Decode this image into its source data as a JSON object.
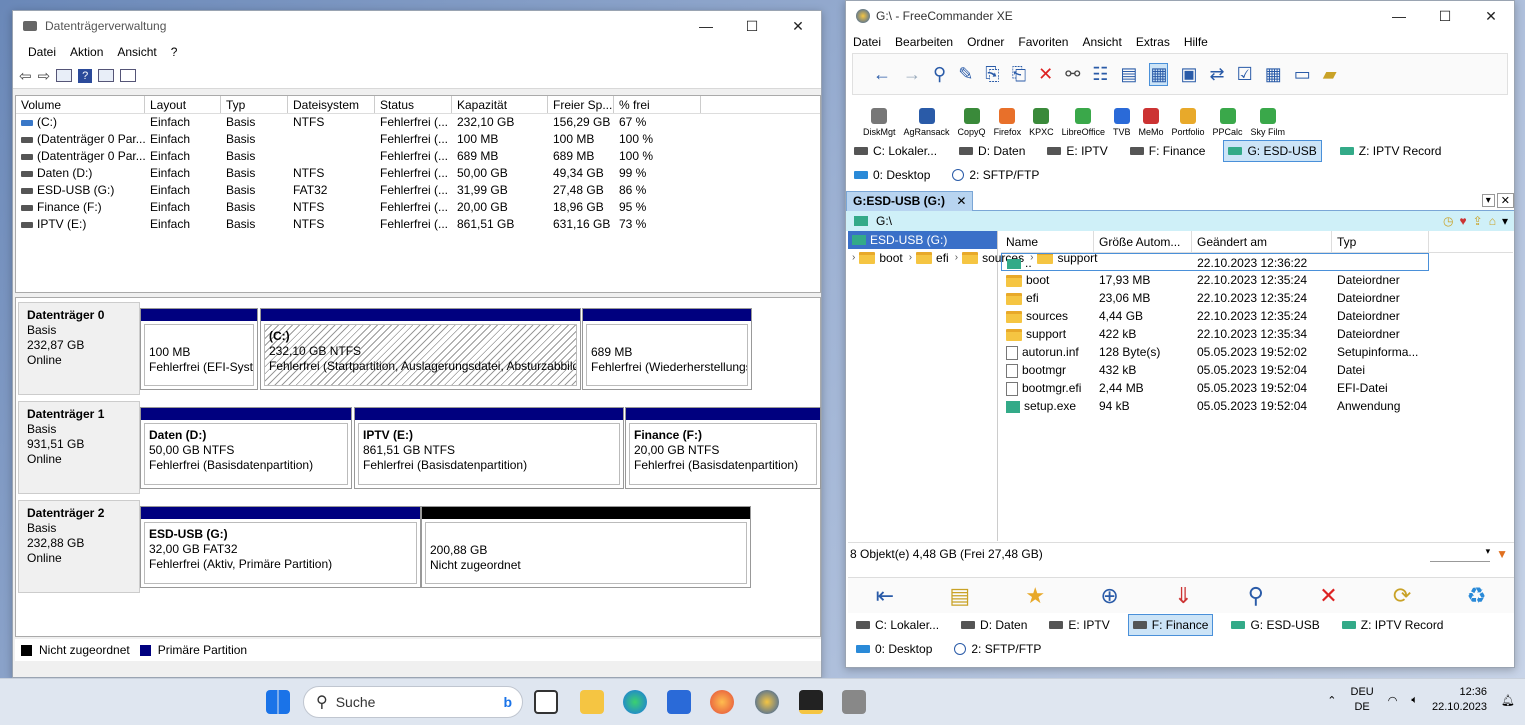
{
  "dm": {
    "title": "Datenträgerverwaltung",
    "menu": [
      "Datei",
      "Aktion",
      "Ansicht",
      "?"
    ],
    "columns": [
      "Volume",
      "Layout",
      "Typ",
      "Dateisystem",
      "Status",
      "Kapazität",
      "Freier Sp...",
      "% frei"
    ],
    "volumes": [
      [
        "(C:)",
        "Einfach",
        "Basis",
        "NTFS",
        "Fehlerfrei (...",
        "232,10 GB",
        "156,29 GB",
        "67 %"
      ],
      [
        "(Datenträger 0 Par...",
        "Einfach",
        "Basis",
        "",
        "Fehlerfrei (...",
        "100 MB",
        "100 MB",
        "100 %"
      ],
      [
        "(Datenträger 0 Par...",
        "Einfach",
        "Basis",
        "",
        "Fehlerfrei (...",
        "689 MB",
        "689 MB",
        "100 %"
      ],
      [
        "Daten (D:)",
        "Einfach",
        "Basis",
        "NTFS",
        "Fehlerfrei (...",
        "50,00 GB",
        "49,34 GB",
        "99 %"
      ],
      [
        "ESD-USB (G:)",
        "Einfach",
        "Basis",
        "FAT32",
        "Fehlerfrei (...",
        "31,99 GB",
        "27,48 GB",
        "86 %"
      ],
      [
        "Finance (F:)",
        "Einfach",
        "Basis",
        "NTFS",
        "Fehlerfrei (...",
        "20,00 GB",
        "18,96 GB",
        "95 %"
      ],
      [
        "IPTV (E:)",
        "Einfach",
        "Basis",
        "NTFS",
        "Fehlerfrei (...",
        "861,51 GB",
        "631,16 GB",
        "73 %"
      ]
    ],
    "disks": [
      {
        "name": "Datenträger 0",
        "type": "Basis",
        "size": "232,87 GB",
        "state": "Online",
        "parts": [
          {
            "title": "",
            "line1": "100 MB",
            "line2": "Fehlerfrei (EFI-Syste"
          },
          {
            "title": "(C:)",
            "line1": "232,10 GB NTFS",
            "line2": "Fehlerfrei (Startpartition, Auslagerungsdatei, Absturzabbild"
          },
          {
            "title": "",
            "line1": "689 MB",
            "line2": "Fehlerfrei (Wiederherstellungs"
          }
        ]
      },
      {
        "name": "Datenträger 1",
        "type": "Basis",
        "size": "931,51 GB",
        "state": "Online",
        "parts": [
          {
            "title": "Daten  (D:)",
            "line1": "50,00 GB NTFS",
            "line2": "Fehlerfrei (Basisdatenpartition)"
          },
          {
            "title": "IPTV  (E:)",
            "line1": "861,51 GB NTFS",
            "line2": "Fehlerfrei (Basisdatenpartition)"
          },
          {
            "title": "Finance  (F:)",
            "line1": "20,00 GB NTFS",
            "line2": "Fehlerfrei (Basisdatenpartition)"
          }
        ]
      },
      {
        "name": "Datenträger 2",
        "type": "Basis",
        "size": "232,88 GB",
        "state": "Online",
        "parts": [
          {
            "title": "ESD-USB  (G:)",
            "line1": "32,00 GB FAT32",
            "line2": "Fehlerfrei (Aktiv, Primäre Partition)"
          },
          {
            "title": "",
            "line1": "200,88 GB",
            "line2": "Nicht zugeordnet"
          }
        ]
      }
    ],
    "legend_unalloc": "Nicht zugeordnet",
    "legend_primary": "Primäre Partition",
    "colors": {
      "primary": "#00007f",
      "unallocated": "#000000"
    }
  },
  "fc": {
    "title": "G:\\ - FreeCommander XE",
    "menu": [
      "Datei",
      "Bearbeiten",
      "Ordner",
      "Favoriten",
      "Ansicht",
      "Extras",
      "Hilfe"
    ],
    "apps": [
      "DiskMgt",
      "AgRansack",
      "CopyQ",
      "Firefox",
      "KPXC",
      "LibreOffice",
      "TVB",
      "MeMo",
      "Portfolio",
      "PPCalc",
      "Sky Film"
    ],
    "drives_top": [
      "C: Lokaler...",
      "D: Daten",
      "E: IPTV",
      "F: Finance",
      "G: ESD-USB",
      "Z: IPTV Record"
    ],
    "drives_top2": [
      "0: Desktop",
      "2: SFTP/FTP"
    ],
    "tab": "G:ESD-USB (G:)",
    "path": "G:\\",
    "tree_root": "ESD-USB (G:)",
    "tree": [
      "boot",
      "efi",
      "sources",
      "support"
    ],
    "columns": [
      "Name",
      "Größe Autom...",
      "Geändert am",
      "Typ"
    ],
    "files": [
      [
        "..",
        "",
        "22.10.2023 12:36:22",
        ""
      ],
      [
        "boot",
        "17,93 MB",
        "22.10.2023 12:35:24",
        "Dateiordner"
      ],
      [
        "efi",
        "23,06 MB",
        "22.10.2023 12:35:24",
        "Dateiordner"
      ],
      [
        "sources",
        "4,44 GB",
        "22.10.2023 12:35:24",
        "Dateiordner"
      ],
      [
        "support",
        "422 kB",
        "22.10.2023 12:35:34",
        "Dateiordner"
      ],
      [
        "autorun.inf",
        "128 Byte(s)",
        "05.05.2023 19:52:02",
        "Setupinforma..."
      ],
      [
        "bootmgr",
        "432 kB",
        "05.05.2023 19:52:04",
        "Datei"
      ],
      [
        "bootmgr.efi",
        "2,44 MB",
        "05.05.2023 19:52:04",
        "EFI-Datei"
      ],
      [
        "setup.exe",
        "94 kB",
        "05.05.2023 19:52:04",
        "Anwendung"
      ]
    ],
    "status": "8 Objekt(e)  4,48 GB  (Frei 27,48 GB)",
    "drives_bottom": [
      "C: Lokaler...",
      "D: Daten",
      "E: IPTV",
      "F: Finance",
      "G: ESD-USB",
      "Z: IPTV Record"
    ],
    "drives_bottom2": [
      "0: Desktop",
      "2: SFTP/FTP"
    ]
  },
  "taskbar": {
    "search": "Suche",
    "lang1": "DEU",
    "lang2": "DE",
    "time": "12:36",
    "date": "22.10.2023"
  }
}
